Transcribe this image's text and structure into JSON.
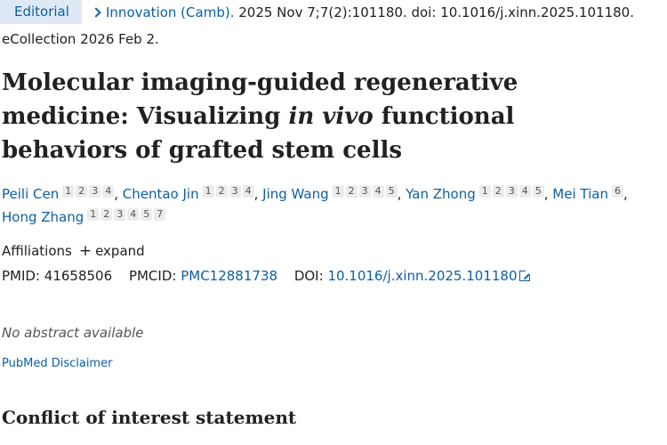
{
  "article_type": "Editorial",
  "citation": {
    "journal": "Innovation (Camb).",
    "details": " 2025 Nov 7;7(2):101180. doi: 10.1016/j.xinn.2025.101180.",
    "ecollection": "eCollection 2026 Feb 2."
  },
  "title": {
    "part1": "Molecular imaging-guided regenerative medicine: Visualizing ",
    "italic": "in vivo",
    "part2": " functional behaviors of grafted stem cells"
  },
  "authors": [
    {
      "name": "Peili Cen",
      "affiliations": [
        "1",
        "2",
        "3",
        "4"
      ]
    },
    {
      "name": "Chentao Jin",
      "affiliations": [
        "1",
        "2",
        "3",
        "4"
      ]
    },
    {
      "name": "Jing Wang",
      "affiliations": [
        "1",
        "2",
        "3",
        "4",
        "5"
      ]
    },
    {
      "name": "Yan Zhong",
      "affiliations": [
        "1",
        "2",
        "3",
        "4",
        "5"
      ]
    },
    {
      "name": "Mei Tian",
      "affiliations": [
        "6"
      ]
    },
    {
      "name": "Hong Zhang",
      "affiliations": [
        "1",
        "2",
        "3",
        "4",
        "5",
        "7"
      ]
    }
  ],
  "affiliations": {
    "label": "Affiliations",
    "expand_label": "expand"
  },
  "identifiers": {
    "pmid_label": "PMID:",
    "pmid": "41658506",
    "pmcid_label": "PMCID:",
    "pmcid": "PMC12881738",
    "doi_label": "DOI:",
    "doi": "10.1016/j.xinn.2025.101180"
  },
  "abstract_note": "No abstract available",
  "disclaimer_link": "PubMed Disclaimer",
  "section_heading": "Conflict of interest statement",
  "icons": {
    "chevron": "chevron-right-icon",
    "plus": "plus-icon",
    "external": "external-link-icon"
  },
  "colors": {
    "link": "#0b5fa5",
    "badge_bg": "#dfe9f5",
    "text": "#212121"
  }
}
